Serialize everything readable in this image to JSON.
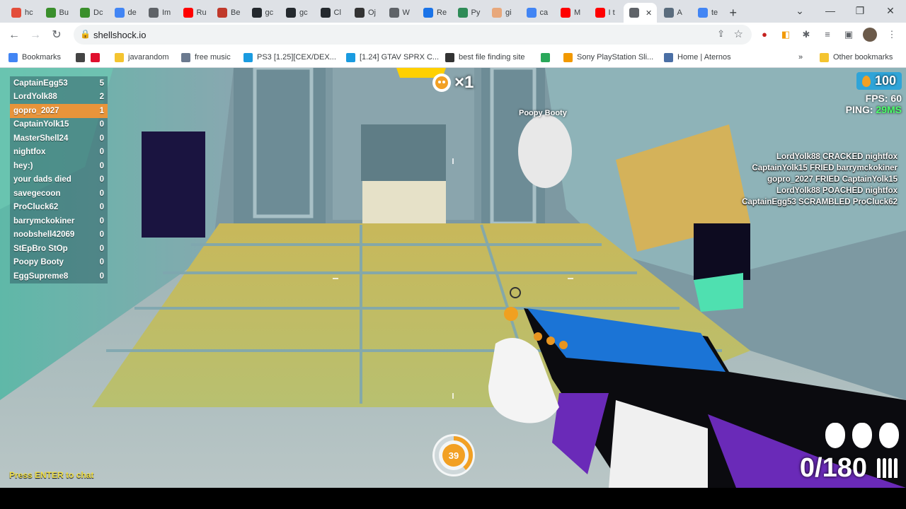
{
  "browser": {
    "tabs": [
      {
        "label": "hc",
        "color": "#e34d3a"
      },
      {
        "label": "Bu",
        "color": "#3a8f2c"
      },
      {
        "label": "Dc",
        "color": "#3a8f2c"
      },
      {
        "label": "de",
        "color": "#4285f4"
      },
      {
        "label": "Im",
        "color": "#5f6368"
      },
      {
        "label": "Ru",
        "color": "#ff0000"
      },
      {
        "label": "Be",
        "color": "#c0392b"
      },
      {
        "label": "gc",
        "color": "#24292e"
      },
      {
        "label": "gc",
        "color": "#24292e"
      },
      {
        "label": "Cl",
        "color": "#24292e"
      },
      {
        "label": "Oj",
        "color": "#333333"
      },
      {
        "label": "W",
        "color": "#5f6368"
      },
      {
        "label": "Re",
        "color": "#1a73e8"
      },
      {
        "label": "Py",
        "color": "#2e8b57"
      },
      {
        "label": "gi",
        "color": "#e8a87c"
      },
      {
        "label": "ca",
        "color": "#4285f4"
      },
      {
        "label": "M",
        "color": "#ff0000"
      },
      {
        "label": "I t",
        "color": "#ff0000"
      },
      {
        "label": "",
        "color": "#5f6368",
        "active": true
      },
      {
        "label": "A",
        "color": "#5a6c7d"
      },
      {
        "label": "te",
        "color": "#4285f4"
      }
    ],
    "new_tab": "+",
    "url": "shellshock.io",
    "bookmarks": [
      {
        "label": "Bookmarks",
        "icon": "grid-icon"
      },
      {
        "label": "",
        "icon": "globe-icon"
      },
      {
        "label": "",
        "icon": "heart-icon"
      },
      {
        "label": "javarandom",
        "icon": "folder-icon"
      },
      {
        "label": "free music",
        "icon": "parachute-icon"
      },
      {
        "label": "PS3 [1.25][CEX/DEX...",
        "icon": "c-icon"
      },
      {
        "label": "[1.24] GTAV SPRX C...",
        "icon": "c-icon"
      },
      {
        "label": "best file finding site",
        "icon": "robot-icon"
      },
      {
        "label": "",
        "icon": "app-icon"
      },
      {
        "label": "Sony PlayStation Sli...",
        "icon": "bag-icon"
      },
      {
        "label": "Home | Aternos",
        "icon": "box-icon"
      }
    ],
    "other_bookmarks": "Other bookmarks",
    "chevron": "»"
  },
  "game": {
    "scoreboard": [
      {
        "name": "CaptainEgg53",
        "score": "5",
        "me": false
      },
      {
        "name": "LordYolk88",
        "score": "2",
        "me": false
      },
      {
        "name": "gopro_2027",
        "score": "1",
        "me": true
      },
      {
        "name": "CaptainYolk15",
        "score": "0",
        "me": false
      },
      {
        "name": "MasterShell24",
        "score": "0",
        "me": false
      },
      {
        "name": "nightfox",
        "score": "0",
        "me": false
      },
      {
        "name": "hey:)",
        "score": "0",
        "me": false
      },
      {
        "name": "your dads died",
        "score": "0",
        "me": false
      },
      {
        "name": "savegecoon",
        "score": "0",
        "me": false
      },
      {
        "name": "ProCluck62",
        "score": "0",
        "me": false
      },
      {
        "name": "barrymckokiner",
        "score": "0",
        "me": false
      },
      {
        "name": "noobshell42069",
        "score": "0",
        "me": false
      },
      {
        "name": "StEpBro StOp",
        "score": "0",
        "me": false
      },
      {
        "name": "Poopy Booty",
        "score": "0",
        "me": false
      },
      {
        "name": "EggSupreme8",
        "score": "0",
        "me": false
      }
    ],
    "killstreak": "×1",
    "nametag": "Poopy Booty",
    "eggs": "100",
    "fps_label": "FPS: ",
    "fps": "60",
    "ping_label": "PING: ",
    "ping": "29MS",
    "killfeed": [
      "LordYolk88 CRACKED nightfox",
      "CaptainYolk15 FRIED barrymckokiner",
      "gopro_2027 FRIED CaptainYolk15",
      "LordYolk88 POACHED nightfox",
      "CaptainEgg53 SCRAMBLED ProCluck62"
    ],
    "health": "39",
    "health_fraction": 0.39,
    "ammo": "0/180",
    "grenades": 3,
    "chat_hint": "Press ENTER to chat"
  },
  "colors": {
    "accent_orange": "#e8943a",
    "ping_green": "#4cff6a",
    "egg_blue": "#2fa4d8"
  }
}
